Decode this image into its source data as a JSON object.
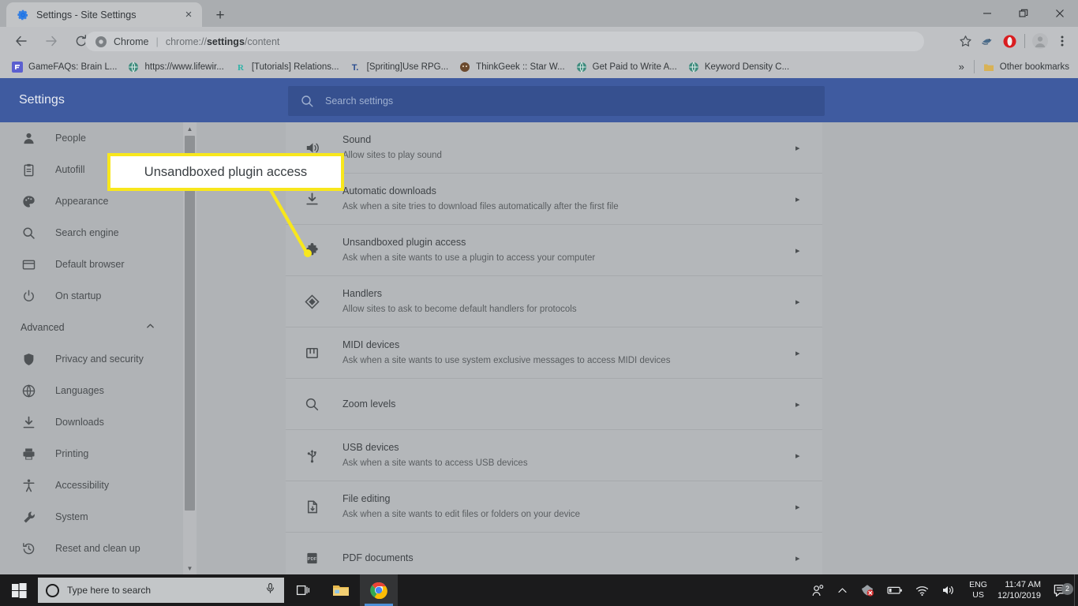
{
  "browser": {
    "tab": {
      "title": "Settings - Site Settings",
      "favicon": "settings-gear-icon",
      "close": "×"
    },
    "newtab_label": "+",
    "window_controls": {
      "minimize": "—",
      "maximize": "❐",
      "close": "✕"
    },
    "nav": {
      "back": "←",
      "forward": "→",
      "reload": "⟳"
    },
    "omnibox": {
      "chip": "Chrome",
      "separator": "|",
      "url_prefix": "chrome://",
      "url_bold": "settings",
      "url_suffix": "/content"
    },
    "toolbar_icons": [
      "bookmark-star-icon",
      "extension-bird-icon",
      "opera-extension-icon",
      "profile-avatar-icon",
      "chrome-menu-icon"
    ],
    "bookmarks": [
      {
        "label": "GameFAQs: Brain L...",
        "icon": "gamefaqs-icon"
      },
      {
        "label": "https://www.lifewir...",
        "icon": "globe-icon"
      },
      {
        "label": "[Tutorials] Relations...",
        "icon": "r-icon"
      },
      {
        "label": "[Spriting]Use RPG...",
        "icon": "t-icon"
      },
      {
        "label": "ThinkGeek :: Star W...",
        "icon": "thinkgeek-icon"
      },
      {
        "label": "Get Paid to Write A...",
        "icon": "globe-icon"
      },
      {
        "label": "Keyword Density C...",
        "icon": "globe-icon"
      }
    ],
    "bookmarks_overflow": "»",
    "other_bookmarks": {
      "label": "Other bookmarks",
      "icon": "folder-icon"
    }
  },
  "settings": {
    "title": "Settings",
    "search": {
      "placeholder": "Search settings",
      "icon": "search-icon"
    },
    "sidebar": {
      "items": [
        {
          "label": "People",
          "icon": "person-icon"
        },
        {
          "label": "Autofill",
          "icon": "clipboard-icon"
        },
        {
          "label": "Appearance",
          "icon": "palette-icon"
        },
        {
          "label": "Search engine",
          "icon": "search-icon"
        },
        {
          "label": "Default browser",
          "icon": "browser-window-icon"
        },
        {
          "label": "On startup",
          "icon": "power-icon"
        }
      ],
      "advanced": {
        "label": "Advanced",
        "caret": "▲"
      },
      "advanced_items": [
        {
          "label": "Privacy and security",
          "icon": "shield-icon"
        },
        {
          "label": "Languages",
          "icon": "globe-icon"
        },
        {
          "label": "Downloads",
          "icon": "download-icon"
        },
        {
          "label": "Printing",
          "icon": "printer-icon"
        },
        {
          "label": "Accessibility",
          "icon": "accessibility-icon"
        },
        {
          "label": "System",
          "icon": "wrench-icon"
        },
        {
          "label": "Reset and clean up",
          "icon": "history-restore-icon"
        }
      ]
    },
    "content_rows": [
      {
        "title": "Sound",
        "sub": "Allow sites to play sound",
        "icon": "sound-icon",
        "arrow": "▸"
      },
      {
        "title": "Automatic downloads",
        "sub": "Ask when a site tries to download files automatically after the first file",
        "icon": "download-icon",
        "arrow": "▸"
      },
      {
        "title": "Unsandboxed plugin access",
        "sub": "Ask when a site wants to use a plugin to access your computer",
        "icon": "puzzle-piece-icon",
        "arrow": "▸"
      },
      {
        "title": "Handlers",
        "sub": "Allow sites to ask to become default handlers for protocols",
        "icon": "handlers-icon",
        "arrow": "▸"
      },
      {
        "title": "MIDI devices",
        "sub": "Ask when a site wants to use system exclusive messages to access MIDI devices",
        "icon": "midi-keyboard-icon",
        "arrow": "▸"
      },
      {
        "title": "Zoom levels",
        "sub": "",
        "icon": "search-icon",
        "arrow": "▸"
      },
      {
        "title": "USB devices",
        "sub": "Ask when a site wants to access USB devices",
        "icon": "usb-icon",
        "arrow": "▸"
      },
      {
        "title": "File editing",
        "sub": "Ask when a site wants to edit files or folders on your device",
        "icon": "file-edit-icon",
        "arrow": "▸"
      },
      {
        "title": "PDF documents",
        "sub": "",
        "icon": "pdf-icon",
        "arrow": "▸"
      }
    ]
  },
  "callout": {
    "text": "Unsandboxed plugin access",
    "border_color": "#f8e71c",
    "fill_color": "#ffffff"
  },
  "taskbar": {
    "start_icon": "windows-start-icon",
    "search": {
      "placeholder": "Type here to search",
      "circle_icon": "cortana-circle-icon",
      "mic_icon": "microphone-icon"
    },
    "apps": [
      {
        "icon": "task-view-icon",
        "name": "task-view"
      },
      {
        "icon": "file-explorer-icon",
        "name": "file-explorer"
      },
      {
        "icon": "chrome-icon",
        "name": "google-chrome",
        "active": true
      }
    ],
    "tray": {
      "people_icon": "people-icon",
      "chevron": "⌃",
      "icons": [
        "antivirus-alert-icon",
        "battery-icon",
        "wifi-icon",
        "volume-icon"
      ],
      "language_line1": "ENG",
      "language_line2": "US",
      "time": "11:47 AM",
      "date": "12/10/2019",
      "notification_count": "2"
    }
  }
}
